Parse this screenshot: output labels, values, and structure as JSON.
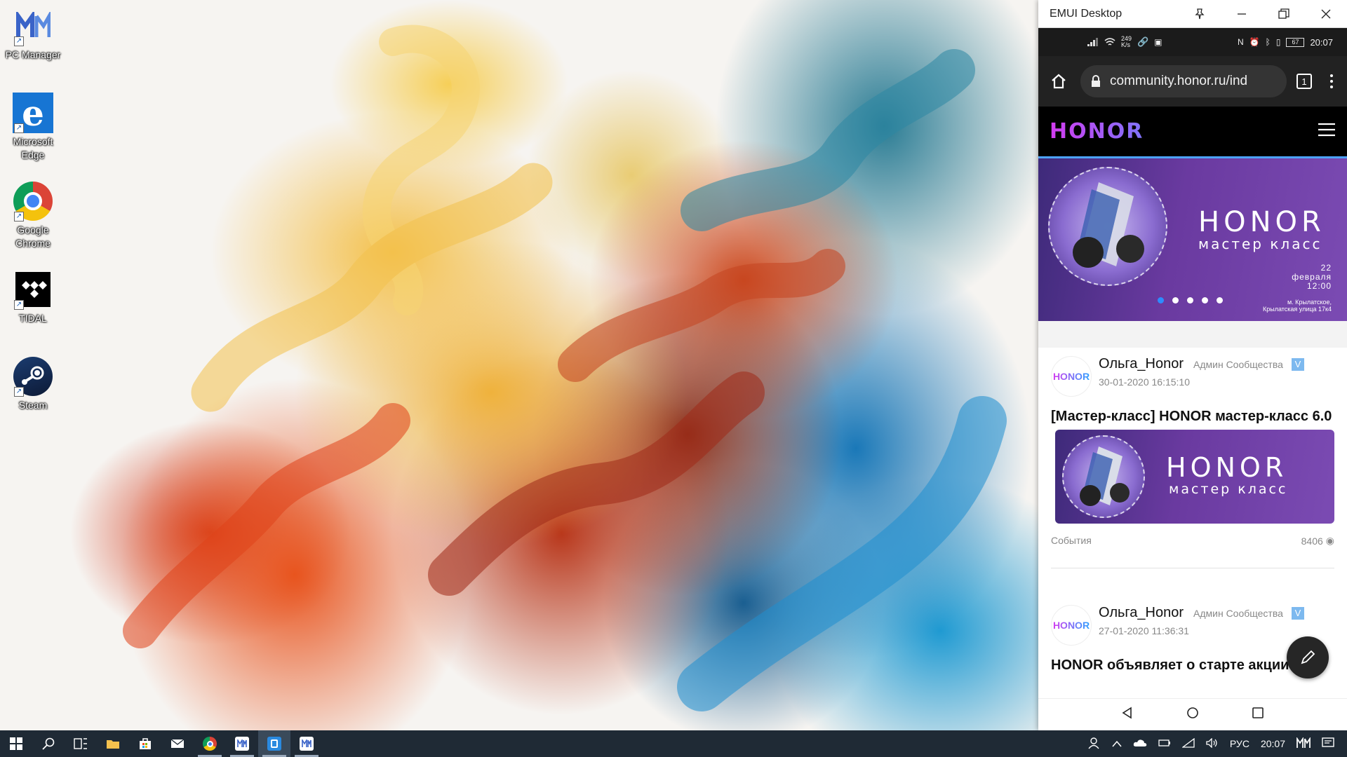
{
  "desktop": {
    "icons": [
      {
        "label": "PC Manager",
        "icon": "pc-manager-icon"
      },
      {
        "label": "Microsoft Edge",
        "icon": "edge-icon"
      },
      {
        "label": "Google Chrome",
        "icon": "chrome-icon"
      },
      {
        "label": "TIDAL",
        "icon": "tidal-icon"
      },
      {
        "label": "Steam",
        "icon": "steam-icon"
      }
    ]
  },
  "taskbar": {
    "apps": [
      "start-icon",
      "search-icon",
      "task-view-icon",
      "file-explorer-icon",
      "store-icon",
      "mail-icon",
      "chrome-icon",
      "pc-manager-icon",
      "emui-desktop-icon",
      "pc-manager-icon"
    ],
    "tray": {
      "language": "РУС",
      "time": "20:07"
    }
  },
  "emui": {
    "window_title": "EMUI Desktop",
    "status_bar": {
      "net_speed_top": "249",
      "net_speed_bottom": "K/s",
      "battery": "67",
      "time": "20:07"
    },
    "browser": {
      "url": "community.honor.ru/ind",
      "tab_count": "1"
    },
    "site": {
      "logo": "HONOR"
    },
    "hero_banner": {
      "brand": "HONOR",
      "subtitle": "мастер класс",
      "date_day": "22",
      "date_month": "февраля",
      "date_time": "12:00",
      "address_1": "м. Крылатское,",
      "address_2": "Крылатская улица 17к4"
    },
    "posts": [
      {
        "avatar": "HONOR",
        "author": "Ольга_Honor",
        "role": "Админ Сообщества",
        "date": "30-01-2020 16:15:10",
        "title": "[Мастер-класс] HONOR мастер-класс 6.0",
        "image_brand": "HONOR",
        "image_subtitle": "мастер класс",
        "category": "События",
        "views": "8406"
      },
      {
        "avatar": "HONOR",
        "author": "Ольга_Honor",
        "role": "Админ Сообщества",
        "date": "27-01-2020 11:36:31",
        "title": "HONOR объявляет о старте акции"
      }
    ]
  },
  "colors": {
    "taskbar": "#1f2a35",
    "honor_accent": "#4da3ff",
    "banner_purple": "#6a3aa0"
  }
}
